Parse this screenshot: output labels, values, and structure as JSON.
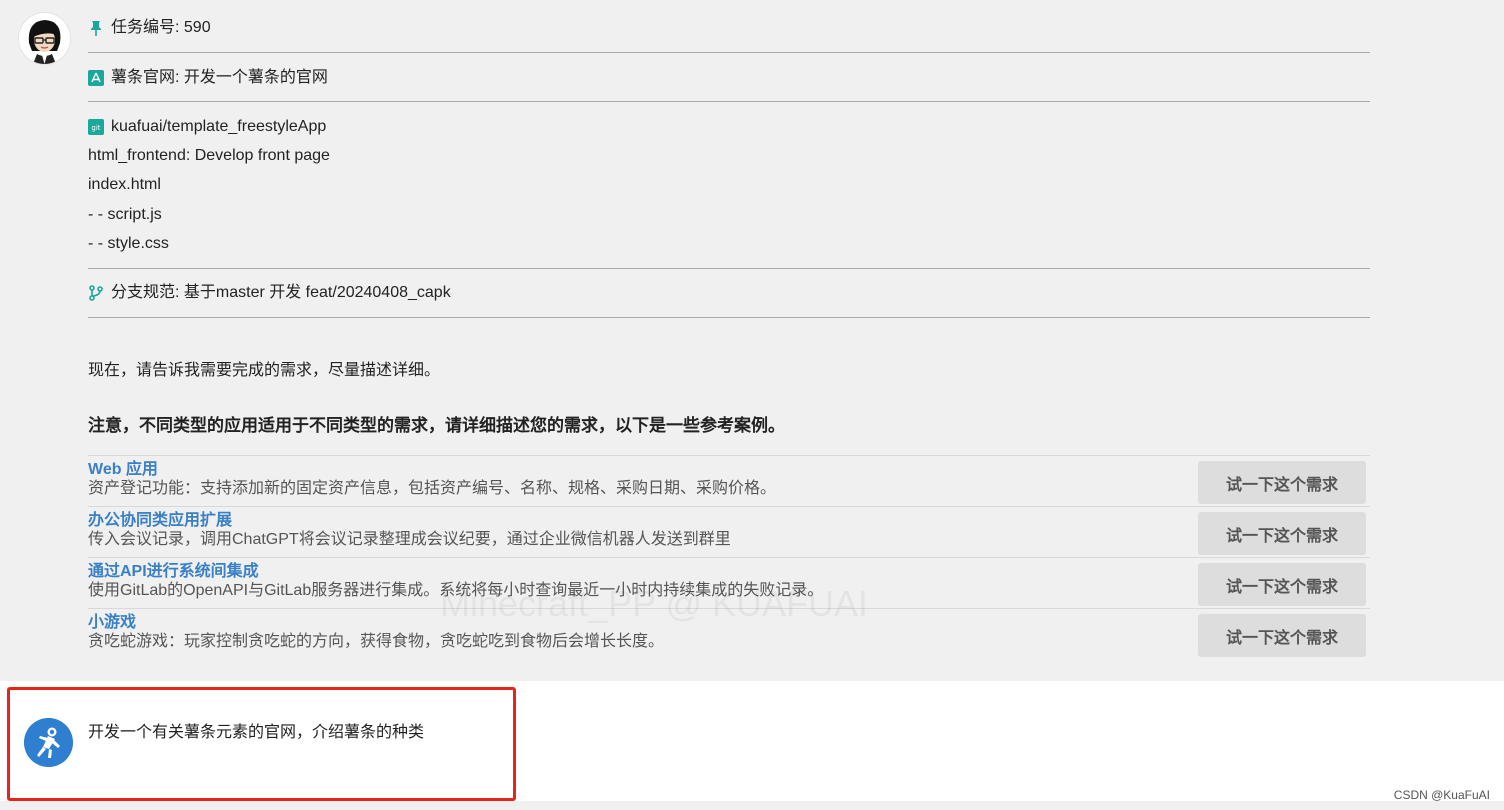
{
  "task": {
    "id_label": "任务编号: 590",
    "project_label": "薯条官网: 开发一个薯条的官网",
    "repo_label": "kuafuai/template_freestyleApp",
    "files": [
      "html_frontend: Develop front page",
      "index.html",
      "- - script.js",
      "- - style.css"
    ],
    "branch_label": "分支规范: 基于master 开发 feat/20240408_capk"
  },
  "prompt": "现在，请告诉我需要完成的需求，尽量描述详细。",
  "notice": "注意，不同类型的应用适用于不同类型的需求，请详细描述您的需求，以下是一些参考案例。",
  "examples": [
    {
      "title": "Web 应用",
      "desc": "资产登记功能：支持添加新的固定资产信息，包括资产编号、名称、规格、采购日期、采购价格。",
      "button": "试一下这个需求"
    },
    {
      "title": "办公协同类应用扩展",
      "desc": "传入会议记录，调用ChatGPT将会议记录整理成会议纪要，通过企业微信机器人发送到群里",
      "button": "试一下这个需求"
    },
    {
      "title": "通过API进行系统间集成",
      "desc": "使用GitLab的OpenAPI与GitLab服务器进行集成。系统将每小时查询最近一小时内持续集成的失败记录。",
      "button": "试一下这个需求"
    },
    {
      "title": "小游戏",
      "desc": "贪吃蛇游戏：玩家控制贪吃蛇的方向，获得食物，贪吃蛇吃到食物后会增长长度。",
      "button": "试一下这个需求"
    }
  ],
  "watermark": "Minecraft_PP @ KUAFUAI",
  "user_message": "开发一个有关薯条元素的官网，介绍薯条的种类",
  "credit": "CSDN @KuaFuAI",
  "colors": {
    "accent": "#1aa89c",
    "link": "#3a80c7",
    "highlight_border": "#e8231b",
    "user_avatar": "#2e7fd0"
  },
  "icons": {
    "task": "pin-icon",
    "project": "app-store-icon",
    "repo": "git-icon",
    "branch": "branch-icon"
  }
}
